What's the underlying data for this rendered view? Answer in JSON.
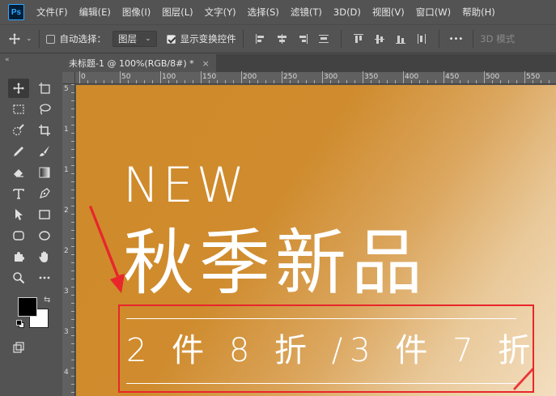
{
  "app": {
    "logo_text": "Ps"
  },
  "menu": {
    "items": [
      "文件(F)",
      "编辑(E)",
      "图像(I)",
      "图层(L)",
      "文字(Y)",
      "选择(S)",
      "滤镜(T)",
      "3D(D)",
      "视图(V)",
      "窗口(W)",
      "帮助(H)"
    ]
  },
  "options": {
    "auto_select_label": "自动选择：",
    "auto_select_checked": false,
    "layer_dropdown_value": "图层",
    "show_transform_label": "显示变换控件",
    "show_transform_checked": true,
    "more_label": "•••",
    "mode_3d_label": "3D 模式"
  },
  "document": {
    "tab_title": "未标题-1 @ 100%(RGB/8#) *",
    "close_glyph": "×"
  },
  "ruler": {
    "h_labels": [
      "0",
      "50",
      "100",
      "150",
      "200",
      "250",
      "300",
      "350",
      "400",
      "450",
      "500",
      "550"
    ],
    "v_labels": [
      "5",
      "1",
      "1",
      "2",
      "2",
      "3",
      "3",
      "4"
    ]
  },
  "canvas": {
    "headline_en": "NEW",
    "headline_cn": "秋季新品",
    "promo_text": "2 件 8 折 /3 件 7 折",
    "gradient_colors": [
      "#cf8a2b",
      "#f3dec0"
    ]
  },
  "annotation": {
    "color": "#e8262b"
  },
  "tools": [
    "move-tool",
    "artboard-tool",
    "marquee-tool",
    "lasso-tool",
    "quick-select-tool",
    "crop-tool",
    "eyedropper-tool",
    "brush-tool",
    "eraser-tool",
    "gradient-tool",
    "type-tool",
    "pen-tool",
    "path-select-tool",
    "rectangle-tool",
    "rounded-rect-tool",
    "ellipse-tool",
    "custom-shape-tool",
    "hand-tool",
    "zoom-tool",
    "more-tools"
  ],
  "colors": {
    "foreground": "#000000",
    "background": "#ffffff"
  }
}
